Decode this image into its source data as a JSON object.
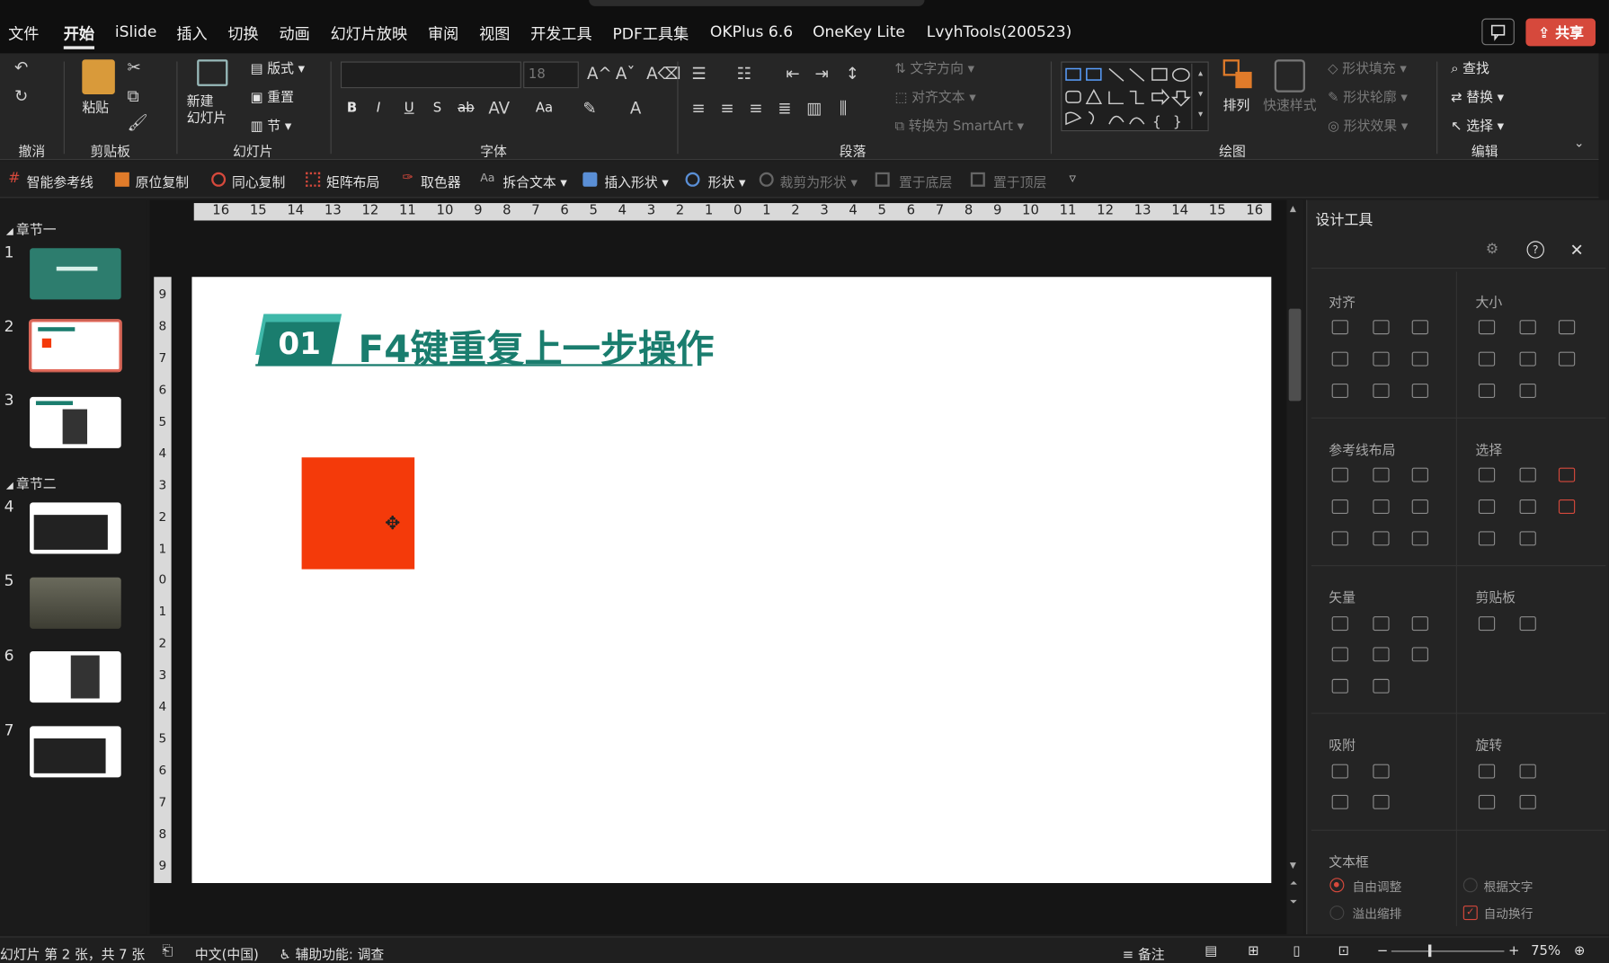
{
  "menu": {
    "items": [
      "文件",
      "开始",
      "iSlide",
      "插入",
      "切换",
      "动画",
      "幻灯片放映",
      "审阅",
      "视图",
      "开发工具",
      "PDF工具集",
      "OKPlus 6.6",
      "OneKey Lite",
      "LvyhTools(200523)"
    ],
    "active": "开始",
    "share_label": "共享"
  },
  "ribbon": {
    "undo_group": "撤消",
    "clipboard": {
      "paste": "粘贴",
      "group": "剪贴板"
    },
    "slides": {
      "new_slide": "新建\n幻灯片",
      "layout": "版式",
      "reset": "重置",
      "section": "节",
      "group": "幻灯片"
    },
    "font": {
      "name_value": "",
      "size_value": "18",
      "group": "字体",
      "bold": "B",
      "italic": "I",
      "underline": "U",
      "shadow": "S",
      "strike": "ab",
      "case": "Aa"
    },
    "paragraph": {
      "text_direction": "文字方向",
      "align_text": "对齐文本",
      "smartart": "转换为 SmartArt",
      "group": "段落"
    },
    "drawing": {
      "arrange": "排列",
      "quick_styles": "快速样式",
      "fill": "形状填充",
      "outline": "形状轮廓",
      "effects": "形状效果",
      "group": "绘图"
    },
    "editing": {
      "find": "查找",
      "replace": "替换",
      "select": "选择",
      "group": "编辑"
    }
  },
  "quickbar": [
    "智能参考线",
    "原位复制",
    "同心复制",
    "矩阵布局",
    "取色器",
    "拆合文本",
    "插入形状",
    "形状",
    "裁剪为形状",
    "置于底层",
    "置于顶层"
  ],
  "sidebar": {
    "sections": [
      "章节一",
      "章节二"
    ],
    "slides": [
      "1",
      "2",
      "3",
      "4",
      "5",
      "6",
      "7"
    ],
    "selected": 2
  },
  "ruler": {
    "h": [
      "16",
      "15",
      "14",
      "13",
      "12",
      "11",
      "10",
      "9",
      "8",
      "7",
      "6",
      "5",
      "4",
      "3",
      "2",
      "1",
      "0",
      "1",
      "2",
      "3",
      "4",
      "5",
      "6",
      "7",
      "8",
      "9",
      "10",
      "11",
      "12",
      "13",
      "14",
      "15",
      "16"
    ],
    "v": [
      "9",
      "8",
      "7",
      "6",
      "5",
      "4",
      "3",
      "2",
      "1",
      "0",
      "1",
      "2",
      "3",
      "4",
      "5",
      "6",
      "7",
      "8",
      "9"
    ]
  },
  "slide": {
    "badge": "01",
    "title": "F4键重复上一步操作",
    "shape_color": "#f43a0a",
    "accent": "#1a7d6e"
  },
  "panel": {
    "title": "设计工具",
    "sections": {
      "align": "对齐",
      "size": "大小",
      "guides": "参考线布局",
      "select": "选择",
      "vector": "矢量",
      "clipboard": "剪贴板",
      "snap": "吸附",
      "rotate": "旋转",
      "textbox": "文本框"
    },
    "textbox_options": {
      "autofit": "自由调整",
      "fit_text": "根据文字",
      "overflow": "溢出缩排",
      "wrap": "自动换行"
    }
  },
  "status": {
    "slide_info": "幻灯片 第 2 张，共 7 张",
    "language": "中文(中国)",
    "accessibility": "辅助功能: 调查",
    "notes": "备注",
    "zoom": "75%"
  }
}
